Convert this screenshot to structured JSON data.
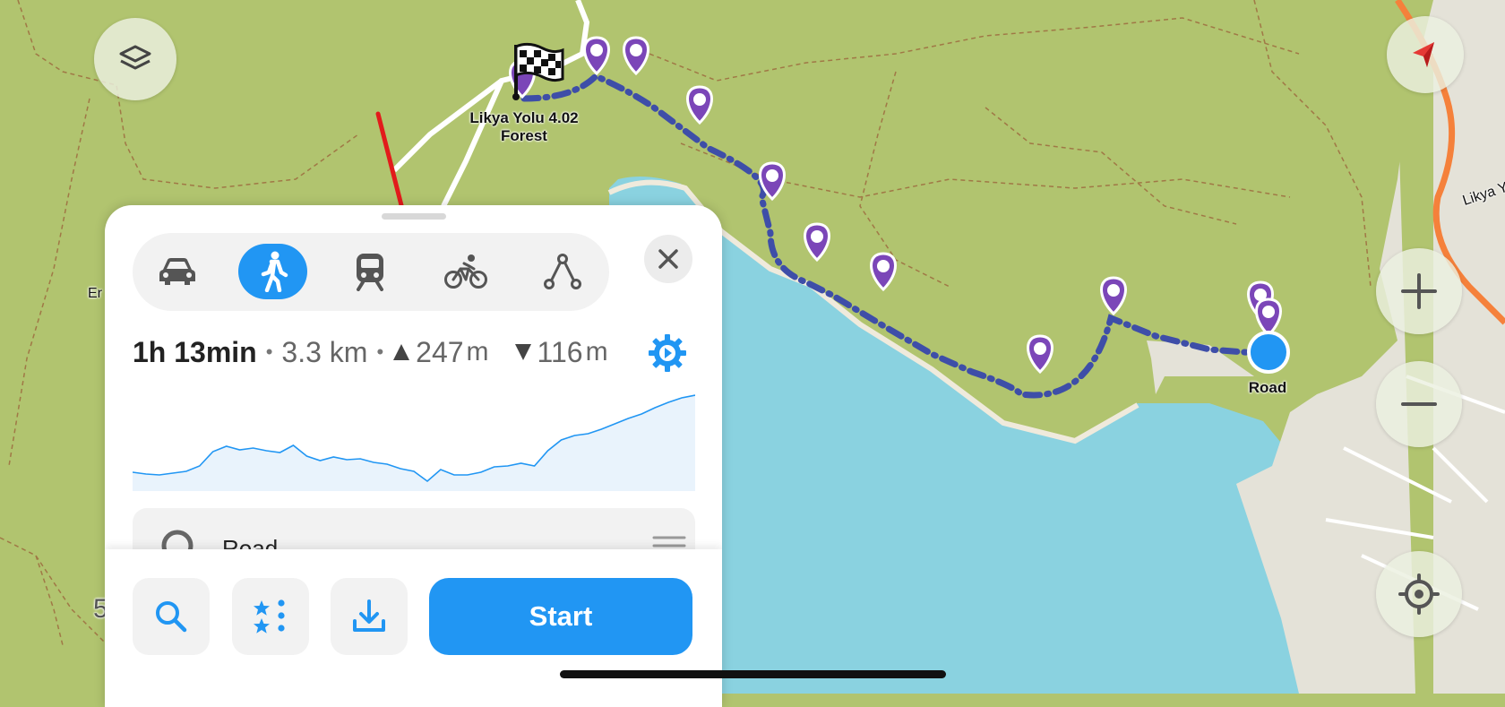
{
  "map": {
    "start_flag_label": "Likya Yolu 4.02\nForest",
    "end_label": "Road",
    "side_label_right": "Likya Y",
    "side_label_left": "Er",
    "scale_fragment": "5",
    "colors": {
      "land": "#b1c46f",
      "water": "#8ad2e0",
      "urban": "#e4e2d8",
      "route": "#3e4ea8",
      "pin": "#7b46b8",
      "highway": "#f5813b"
    }
  },
  "controls": {
    "layers_icon": "layers-icon",
    "compass_icon": "compass-icon",
    "zoom_in_icon": "plus-icon",
    "zoom_out_icon": "minus-icon",
    "locate_icon": "crosshair-icon"
  },
  "panel": {
    "modes": [
      {
        "name": "car",
        "icon": "car-icon",
        "active": false
      },
      {
        "name": "walk",
        "icon": "walk-icon",
        "active": true
      },
      {
        "name": "transit",
        "icon": "train-icon",
        "active": false
      },
      {
        "name": "bike",
        "icon": "bike-icon",
        "active": false
      },
      {
        "name": "route-planner",
        "icon": "route-points-icon",
        "active": false
      }
    ],
    "route_summary": {
      "time": "1h 13min",
      "distance": "3.3 km",
      "ascent": "247",
      "ascent_unit": "m",
      "descent": "116",
      "descent_unit": "m"
    },
    "elevation_profile": [
      0.14,
      0.12,
      0.11,
      0.13,
      0.15,
      0.21,
      0.37,
      0.43,
      0.39,
      0.41,
      0.38,
      0.36,
      0.44,
      0.32,
      0.27,
      0.31,
      0.28,
      0.29,
      0.25,
      0.23,
      0.18,
      0.15,
      0.04,
      0.17,
      0.11,
      0.11,
      0.14,
      0.2,
      0.21,
      0.24,
      0.21,
      0.38,
      0.5,
      0.55,
      0.57,
      0.62,
      0.68,
      0.74,
      0.79,
      0.86,
      0.92,
      0.97,
      1.0
    ],
    "waypoint_row_label": "Road",
    "bottom_buttons": {
      "search_icon": "search-icon",
      "favorites_icon": "star-list-icon",
      "download_icon": "download-icon",
      "start_label": "Start"
    }
  }
}
